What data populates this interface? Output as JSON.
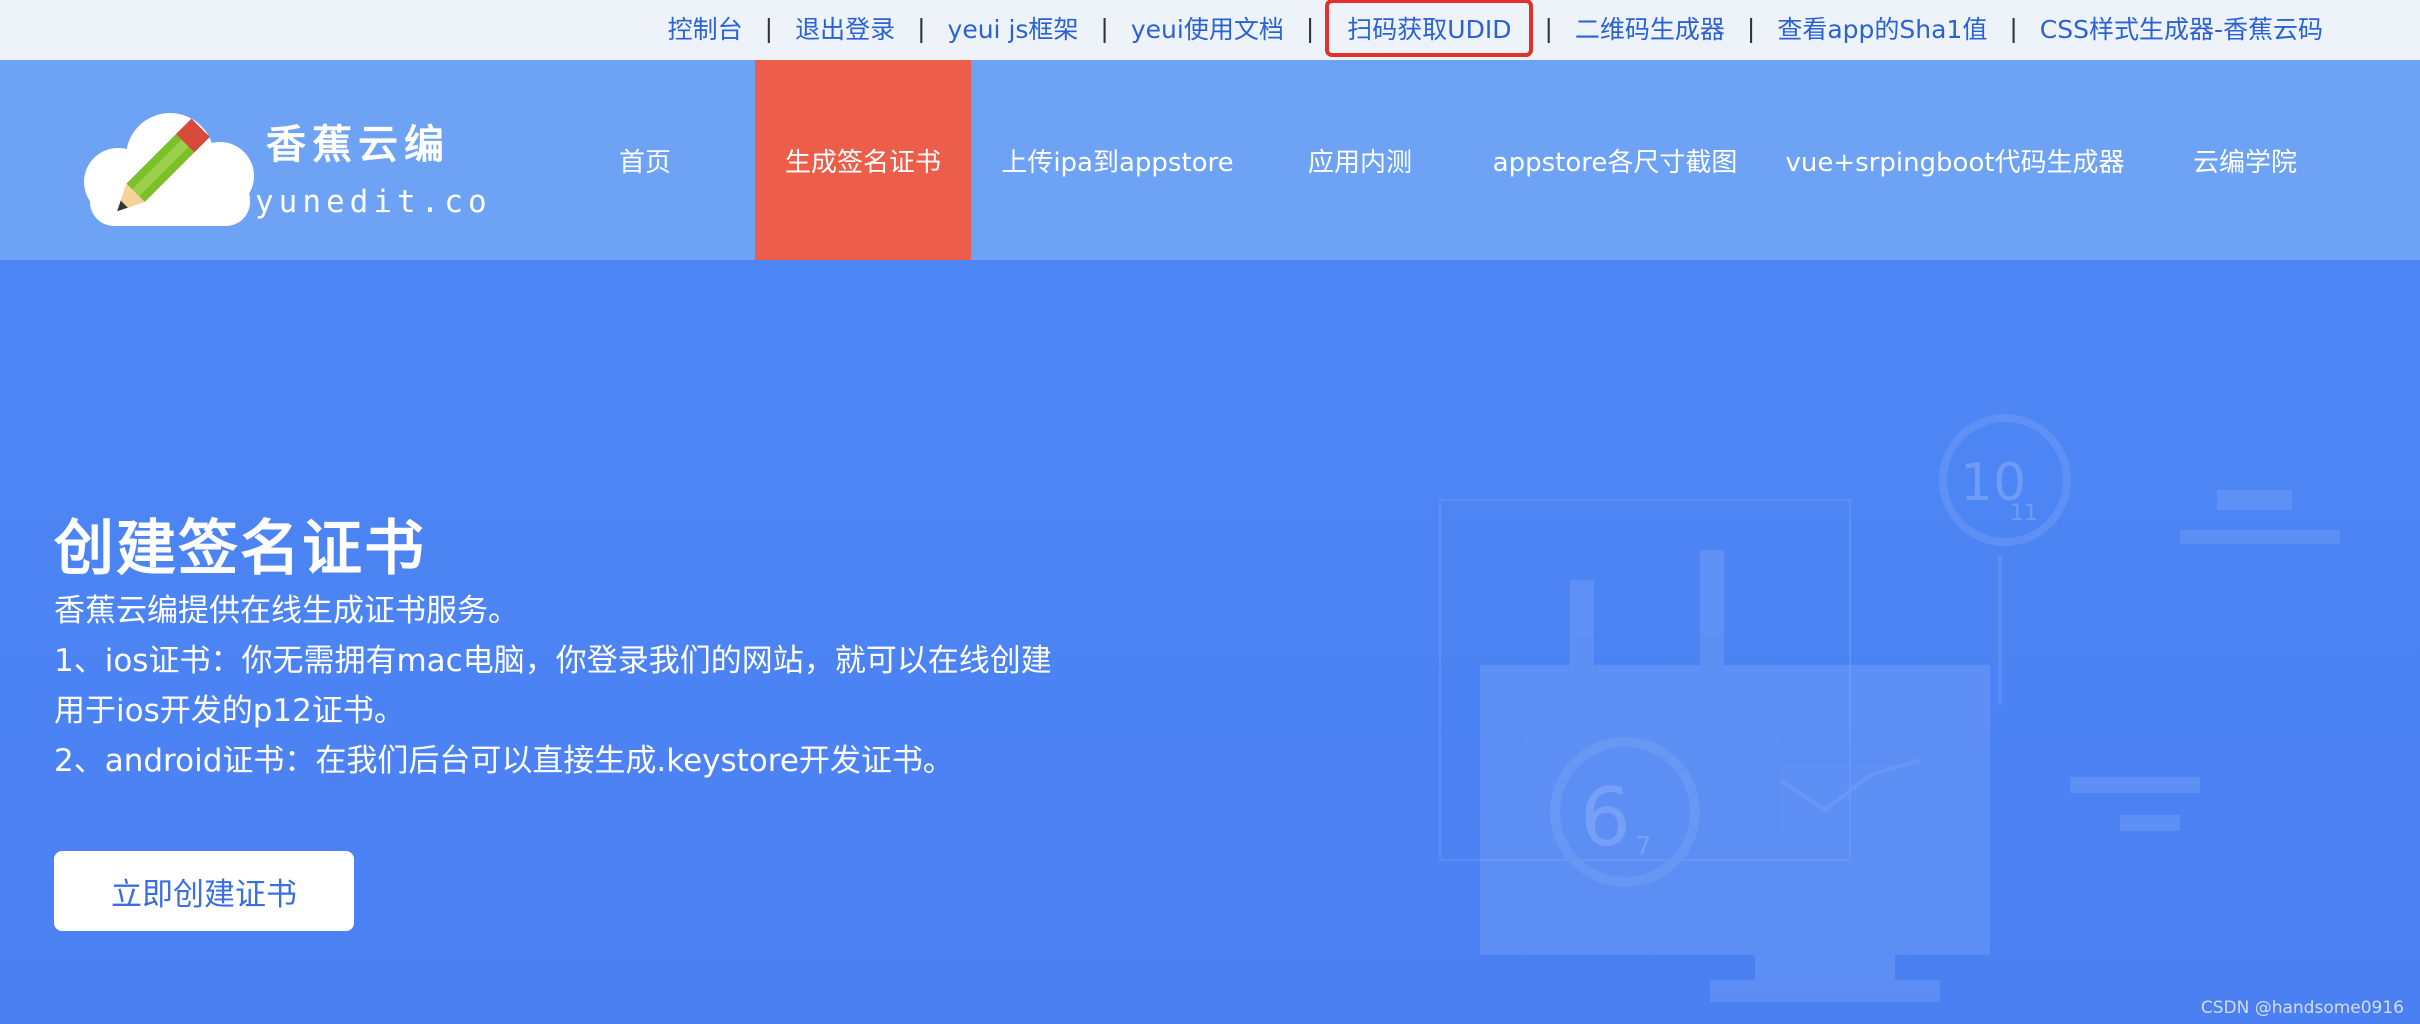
{
  "topbar": {
    "links": [
      "控制台",
      "退出登录",
      "yeui js框架",
      "yeui使用文档",
      "扫码获取UDID",
      "二维码生成器",
      "查看app的Sha1值",
      "CSS样式生成器-香蕉云码"
    ],
    "separator": "|",
    "highlighted_index": 4,
    "highlight_color": "#e0312b"
  },
  "logo": {
    "name": "香蕉云编",
    "domain": "yunedit.com"
  },
  "nav": {
    "items": [
      "首页",
      "生成签名证书",
      "上传ipa到appstore",
      "应用内测",
      "appstore各尺寸截图",
      "vue+srpingboot代码生成器",
      "云编学院"
    ],
    "active_index": 1,
    "active_color": "#ec5e4a"
  },
  "hero": {
    "title": "创建签名证书",
    "lines": [
      "香蕉云编提供在线生成证书服务。",
      "1、ios证书：你无需拥有mac电脑，你登录我们的网站，就可以在线创建用于ios开发的p12证书。",
      "2、android证书：在我们后台可以直接生成.keystore开发证书。"
    ],
    "button_label": "立即创建证书",
    "illustration_numbers": [
      "10",
      "11",
      "6",
      "7"
    ]
  },
  "watermark": "CSDN @handsome0916"
}
